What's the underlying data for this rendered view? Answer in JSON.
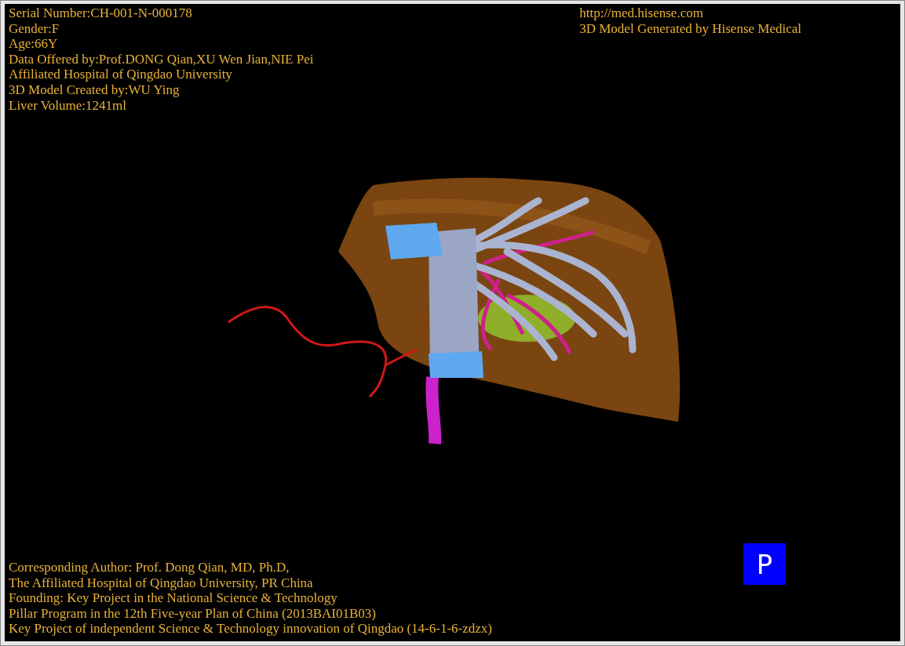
{
  "patient_info": [
    "Serial Number:CH-001-N-000178",
    "Gender:F",
    "Age:66Y",
    "Data Offered by:Prof.DONG Qian,XU Wen Jian,NIE Pei",
    "Affiliated Hospital of Qingdao University",
    "3D Model Created by:WU Ying",
    "Liver Volume:1241ml"
  ],
  "vendor_info": [
    "http://med.hisense.com",
    "3D Model Generated by Hisense Medical"
  ],
  "credits": [
    "Corresponding Author: Prof. Dong Qian, MD, Ph.D,",
    "The Affiliated Hospital of Qingdao University, PR China",
    "Founding: Key Project in the National Science & Technology",
    "Pillar Program in the 12th Five-year Plan of China (2013BAI01B03)",
    "Key Project of independent Science & Technology innovation of Qingdao (14-6-1-6-zdzx)"
  ],
  "view_button": {
    "label": "P"
  }
}
